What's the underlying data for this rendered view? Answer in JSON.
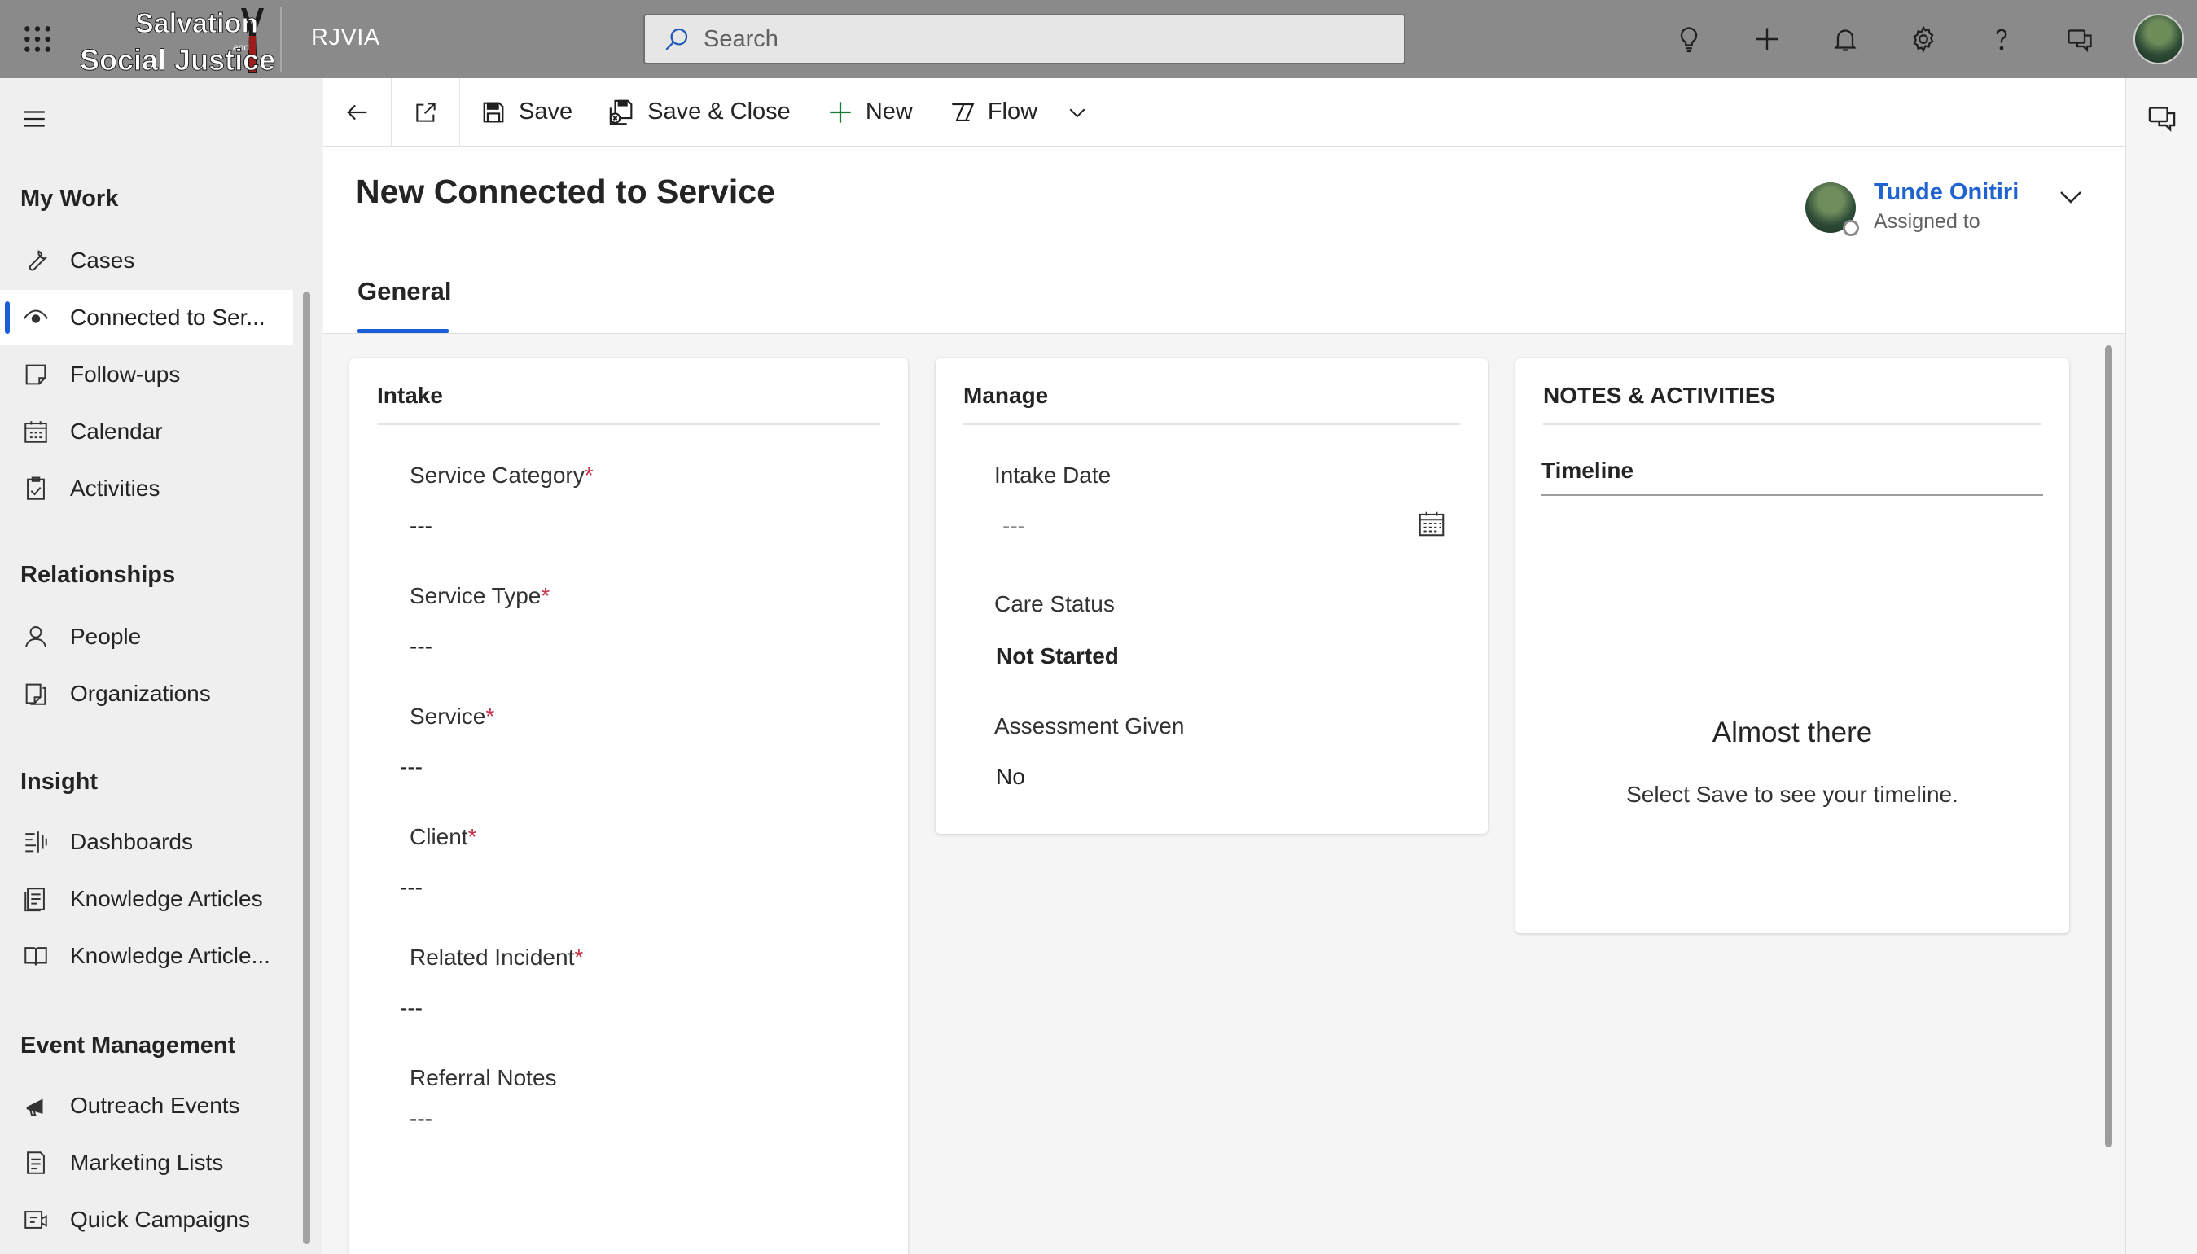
{
  "topbar": {
    "app_name": "RJVIA",
    "logo_text_line1": "Salvation",
    "logo_text_line2": "Social Justice",
    "logo_text_and": "and",
    "search_placeholder": "Search",
    "background": "#8a8a8a"
  },
  "nav": {
    "groups": {
      "my_work": "My Work",
      "relationships": "Relationships",
      "insight": "Insight",
      "event_management": "Event Management"
    },
    "items": {
      "cases": "Cases",
      "connected": "Connected to Ser...",
      "followups": "Follow-ups",
      "calendar": "Calendar",
      "activities": "Activities",
      "people": "People",
      "organizations": "Organizations",
      "dashboards": "Dashboards",
      "knowledge_articles": "Knowledge Articles",
      "knowledge_articles_2": "Knowledge Article...",
      "outreach_events": "Outreach Events",
      "marketing_lists": "Marketing Lists",
      "quick_campaigns": "Quick Campaigns"
    },
    "active_item": "connected"
  },
  "commands": {
    "save": "Save",
    "save_close": "Save & Close",
    "new": "New",
    "flow": "Flow"
  },
  "header": {
    "title": "New Connected to Service",
    "owner_name": "Tunde Onitiri",
    "owner_role": "Assigned to",
    "tab_general": "General"
  },
  "intake": {
    "title": "Intake",
    "service_category_label": "Service Category",
    "service_category_value": "---",
    "service_type_label": "Service Type",
    "service_type_value": "---",
    "service_label": "Service",
    "service_value": "---",
    "client_label": "Client",
    "client_value": "---",
    "related_incident_label": "Related Incident",
    "related_incident_value": "---",
    "referral_notes_label": "Referral Notes",
    "referral_notes_value": "---",
    "required_marker": "*"
  },
  "manage": {
    "title": "Manage",
    "intake_date_label": "Intake Date",
    "intake_date_value": "---",
    "care_status_label": "Care Status",
    "care_status_value": "Not Started",
    "assessment_label": "Assessment Given",
    "assessment_value": "No"
  },
  "notes": {
    "title": "NOTES & ACTIVITIES",
    "timeline_title": "Timeline",
    "empty_title": "Almost there",
    "empty_sub": "Select Save to see your timeline."
  },
  "colors": {
    "accent": "#1a5dd6",
    "link": "#1f63d1",
    "required": "#c4314b"
  }
}
